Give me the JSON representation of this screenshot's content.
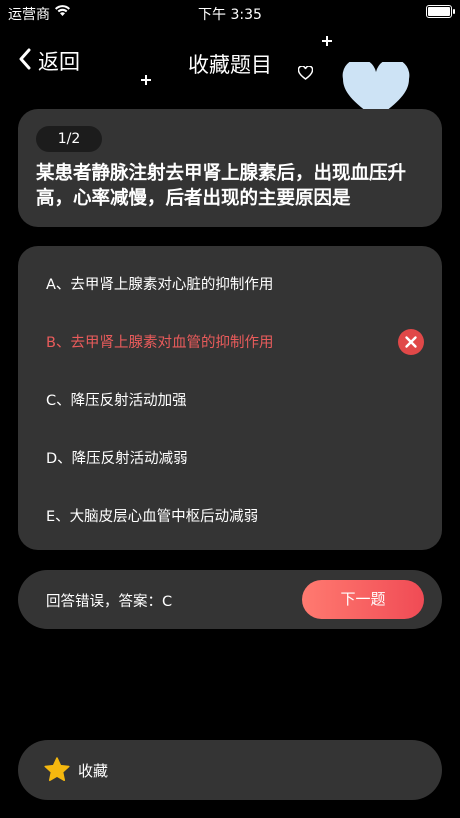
{
  "status_bar": {
    "carrier": "运营商",
    "time": "下午 3:35",
    "battery_level": 1.0
  },
  "nav": {
    "back_label": "返回",
    "title": "收藏题目"
  },
  "question": {
    "progress": "1/2",
    "text": "某患者静脉注射去甲肾上腺素后，出现血压升高，心率减慢，后者出现的主要原因是"
  },
  "options": [
    {
      "label": "A、去甲肾上腺素对心脏的抑制作用",
      "state": "normal"
    },
    {
      "label": "B、去甲肾上腺素对血管的抑制作用",
      "state": "wrong"
    },
    {
      "label": "C、降压反射活动加强",
      "state": "normal"
    },
    {
      "label": "D、降压反射活动减弱",
      "state": "normal"
    },
    {
      "label": "E、大脑皮层心血管中枢后动减弱",
      "state": "normal"
    }
  ],
  "answer": {
    "result_text": "回答错误，答案：C",
    "next_label": "下一题"
  },
  "favorite": {
    "label": "收藏"
  },
  "colors": {
    "background": "#000000",
    "card": "#343434",
    "wrong": "#e85b5b",
    "accent_gradient_start": "#ff7a70",
    "accent_gradient_end": "#f04b55",
    "heart_decoration": "#cde3f5",
    "star": "#f5b80f"
  }
}
